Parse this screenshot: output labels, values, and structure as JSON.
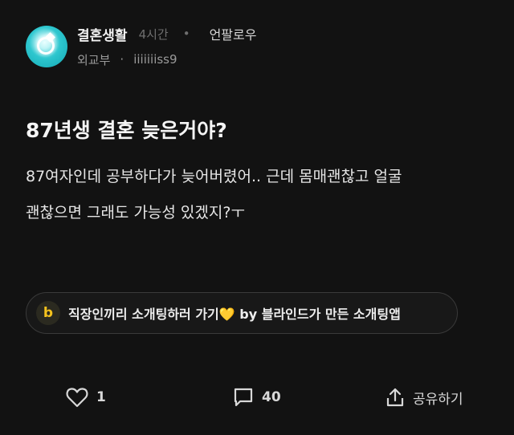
{
  "post": {
    "community": "결혼생활",
    "time_ago": "4시간",
    "separator": "•",
    "unfollow": "언팔로우",
    "author_company": "외교부",
    "author_sep": "·",
    "author_name": "iiiiiiiss9",
    "title": "87년생 결혼 늦은거야?",
    "body_lines": [
      "87여자인데 공부하다가 늦어버렸어.. 근데 몸매괜찮고 얼굴",
      "괜찮으면 그래도 가능성 있겠지?ㅜ"
    ]
  },
  "promo": {
    "logo_letter": "b",
    "text": "직장인끼리 소개팅하러 가기💛 by 블라인드가 만든 소개팅앱"
  },
  "actions": {
    "like_count": "1",
    "comment_count": "40",
    "share_label": "공유하기"
  },
  "icons": {
    "avatar": "ring-image",
    "like": "heart-icon",
    "comment": "comment-icon",
    "share": "share-icon"
  }
}
